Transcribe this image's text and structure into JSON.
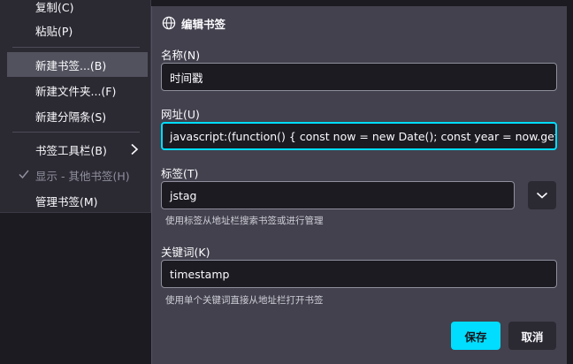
{
  "menu": {
    "items": [
      {
        "label": "复制(C)"
      },
      {
        "label": "粘贴(P)"
      },
      {
        "label": "新建书签...(B)"
      },
      {
        "label": "新建文件夹...(F)"
      },
      {
        "label": "新建分隔条(S)"
      },
      {
        "label": "书签工具栏(B)"
      },
      {
        "label": "显示 - 其他书签(H)"
      },
      {
        "label": "管理书签(M)"
      }
    ]
  },
  "dialog": {
    "title": "编辑书签",
    "name_label": "名称(N)",
    "name_value": "时间戳",
    "url_label": "网址(U)",
    "url_value": "javascript:(function() {   const now = new Date();   const year = now.getFullYear",
    "tags_label": "标签(T)",
    "tags_value": "jstag",
    "tags_hint": "使用标签从地址栏搜索书签或进行管理",
    "keyword_label": "关键词(K)",
    "keyword_value": "timestamp",
    "keyword_hint": "使用单个关键词直接从地址栏打开书签",
    "save_label": "保存",
    "cancel_label": "取消"
  },
  "colors": {
    "accent": "#00ddff",
    "panel_bg": "#42414d",
    "menu_bg": "#2b2a33",
    "input_bg": "#1c1b22"
  },
  "icons": {
    "header": "globe-icon",
    "submenu": "chevron-right-icon",
    "checked": "checkmark-icon",
    "dropdown": "chevron-down-icon"
  }
}
